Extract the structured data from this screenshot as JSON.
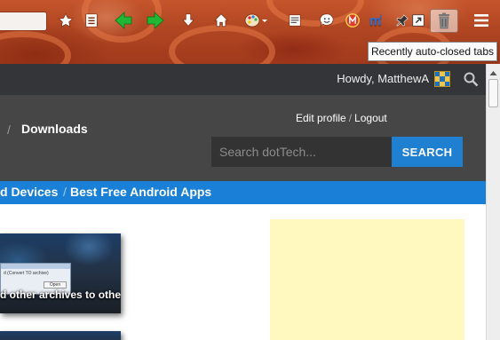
{
  "browser": {
    "tooltip": "Recently auto-closed tabs",
    "icons": [
      "bookmark-star-icon",
      "bookmarks-list-icon",
      "back-arrow-icon",
      "forward-arrow-icon",
      "download-icon",
      "home-icon",
      "palette-icon",
      "reader-icon",
      "smiley-icon",
      "addon-icon",
      "multi-m-icon",
      "pin-icon",
      "popout-icon",
      "trash-icon",
      "menu-icon"
    ],
    "colors": {
      "theme": "#b04622",
      "nav_green": "#21b634"
    }
  },
  "adminbar": {
    "greeting": "Howdy, MatthewA"
  },
  "header": {
    "breadcrumb_separator": "/",
    "breadcrumb_current": "Downloads",
    "edit_profile": "Edit profile",
    "links_separator": "/",
    "logout": "Logout",
    "search_placeholder": "Search dotTech...",
    "search_button": "SEARCH"
  },
  "categories": {
    "item1": "d Devices",
    "separator": "/",
    "item2": "Best Free Android Apps"
  },
  "content": {
    "thumb_caption": "d other archives to other",
    "window_title": "d (Convert TO archive)",
    "window_button": "Open Archive"
  },
  "colors": {
    "accent": "#1a7fd6",
    "header_bg": "#464646",
    "adminbar_bg": "#333538",
    "ad_bg": "#fff9c0"
  }
}
